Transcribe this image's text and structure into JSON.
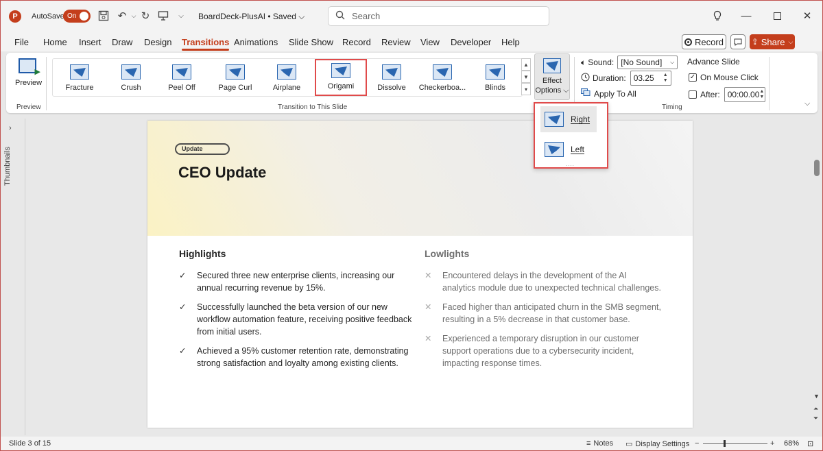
{
  "titlebar": {
    "app_letter": "P",
    "autosave_label": "AutoSave",
    "autosave_state": "On",
    "doc_title": "BoardDeck-PlusAI • Saved ⌵",
    "search_placeholder": "Search"
  },
  "menu": {
    "tabs": [
      "File",
      "Home",
      "Insert",
      "Draw",
      "Design",
      "Transitions",
      "Animations",
      "Slide Show",
      "Record",
      "Review",
      "View",
      "Developer",
      "Help"
    ],
    "active_tab": "Transitions",
    "record_label": "Record",
    "share_label": "Share"
  },
  "ribbon": {
    "preview_label": "Preview",
    "preview_group_label": "Preview",
    "transitions": [
      "Fracture",
      "Crush",
      "Peel Off",
      "Page Curl",
      "Airplane",
      "Origami",
      "Dissolve",
      "Checkerboa...",
      "Blinds"
    ],
    "selected_transition": "Origami",
    "transition_group_label": "Transition to This Slide",
    "effect_options_line1": "Effect",
    "effect_options_line2": "Options ⌵",
    "timing": {
      "sound_label": "Sound:",
      "sound_value": "[No Sound]",
      "duration_label": "Duration:",
      "duration_value": "03.25",
      "apply_all_label": "Apply To All",
      "advance_label": "Advance Slide",
      "on_click_label": "On Mouse Click",
      "on_click_checked": true,
      "after_label": "After:",
      "after_value": "00:00.00",
      "after_checked": false,
      "group_label": "Timing"
    }
  },
  "effect_dropdown": {
    "items": [
      {
        "label": "Right",
        "selected": true
      },
      {
        "label": "Left",
        "selected": false
      }
    ]
  },
  "thumbnails_label": "Thumbnails",
  "slide": {
    "badge": "Update",
    "title": "CEO Update",
    "highlights_heading": "Highlights",
    "lowlights_heading": "Lowlights",
    "highlights": [
      [
        "Secured three new enterprise clients, increasing our",
        "annual recurring revenue by 15%."
      ],
      [
        "Successfully launched the beta version of our new",
        "workflow automation feature, receiving positive feedback",
        "from initial users."
      ],
      [
        "Achieved a 95% customer retention rate, demonstrating",
        "strong satisfaction and loyalty among existing clients."
      ]
    ],
    "lowlights": [
      [
        "Encountered delays in the development of the AI",
        "analytics module due to unexpected technical challenges."
      ],
      [
        "Faced higher than anticipated churn in the SMB segment,",
        "resulting in a 5% decrease in that customer base."
      ],
      [
        "Experienced a temporary disruption in our customer",
        "support operations due to a cybersecurity incident,",
        "impacting response times."
      ]
    ],
    "check_mark": "✓",
    "cross_mark": "✕"
  },
  "status": {
    "slide_counter": "Slide 3 of 15",
    "notes_label": "Notes",
    "display_label": "Display Settings",
    "zoom_minus": "−",
    "zoom_plus": "+",
    "zoom_level": "68%"
  },
  "colors": {
    "accent": "#c43e1c",
    "highlight_box": "#e04a4a",
    "icon_blue": "#2a66b0"
  }
}
